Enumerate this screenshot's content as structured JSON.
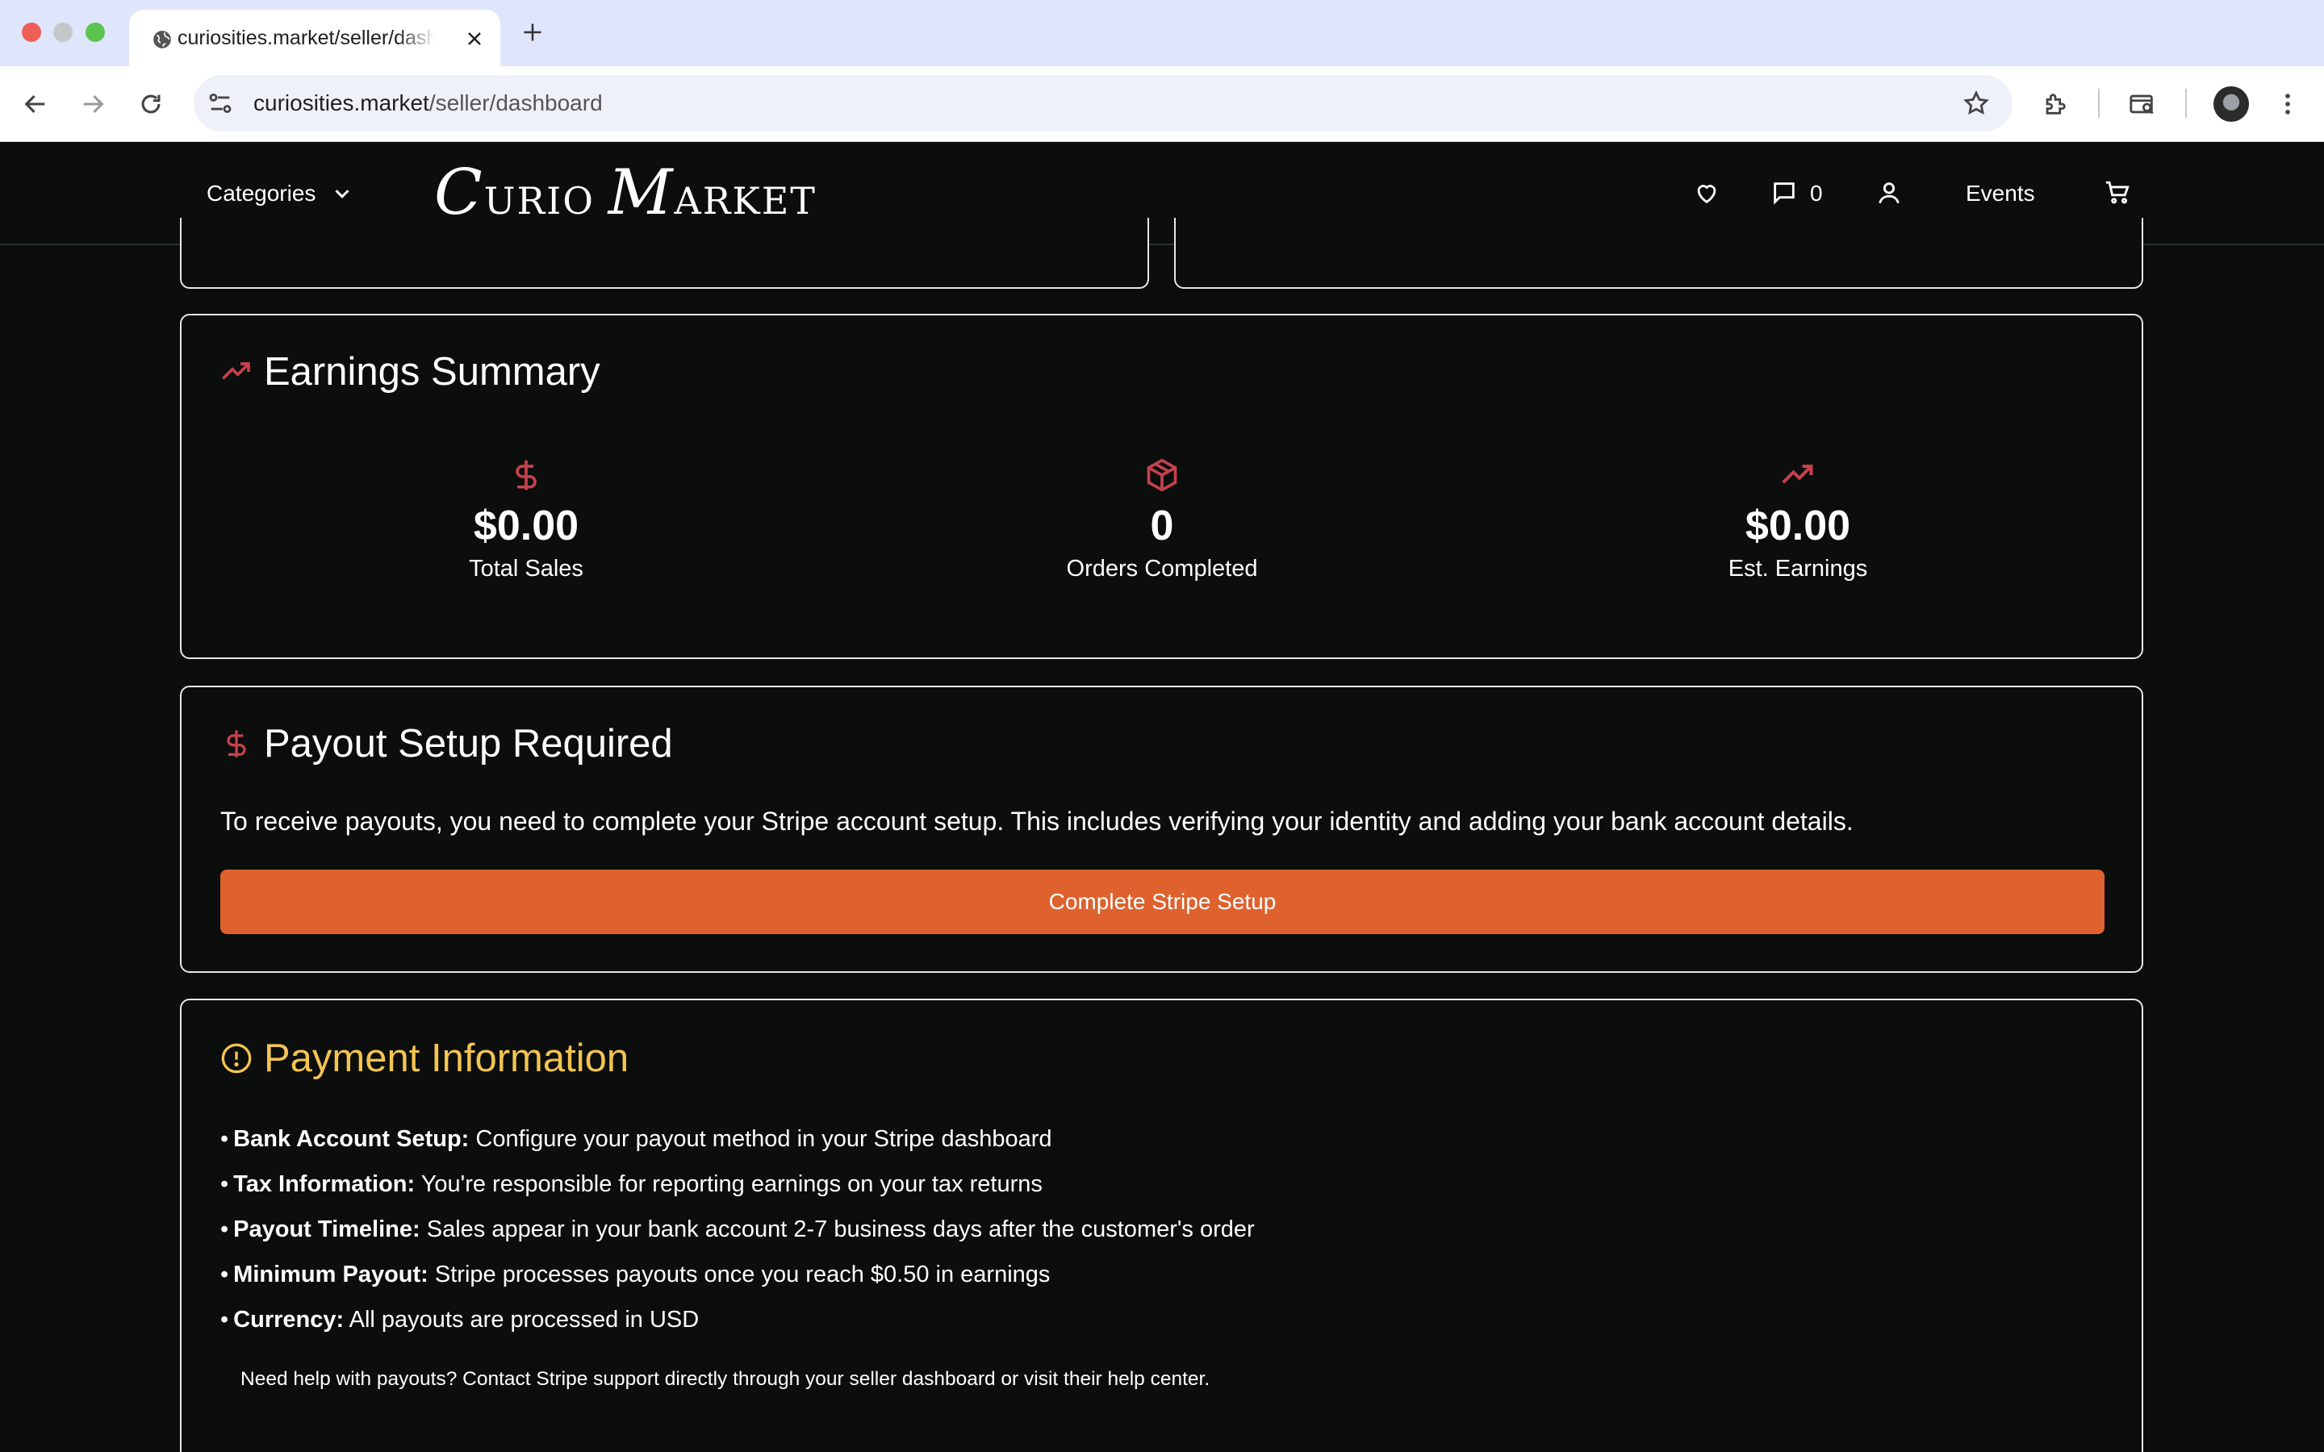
{
  "browser": {
    "tab_title": "curiosities.market/seller/dashboard",
    "url_domain": "curiosities.market",
    "url_path": "/seller/dashboard"
  },
  "header": {
    "categories_label": "Categories",
    "logo_c": "C",
    "logo_urio": "URIO ",
    "logo_m": "M",
    "logo_arket": "ARKET",
    "messages_count": "0",
    "events_label": "Events"
  },
  "earnings": {
    "title": "Earnings Summary",
    "stats": [
      {
        "value": "$0.00",
        "label": "Total Sales",
        "icon": "dollar-icon"
      },
      {
        "value": "0",
        "label": "Orders Completed",
        "icon": "package-icon"
      },
      {
        "value": "$0.00",
        "label": "Est. Earnings",
        "icon": "trending-up-icon"
      }
    ]
  },
  "payout": {
    "title": "Payout Setup Required",
    "text": "To receive payouts, you need to complete your Stripe account setup. This includes verifying your identity and adding your bank account details.",
    "button_label": "Complete Stripe Setup"
  },
  "payment_info": {
    "title": "Payment Information",
    "items": [
      {
        "bold": "Bank Account Setup:",
        "text": " Configure your payout method in your Stripe dashboard"
      },
      {
        "bold": "Tax Information:",
        "text": " You're responsible for reporting earnings on your tax returns"
      },
      {
        "bold": "Payout Timeline:",
        "text": " Sales appear in your bank account 2-7 business days after the customer's order"
      },
      {
        "bold": "Minimum Payout:",
        "text": " Stripe processes payouts once you reach $0.50 in earnings"
      },
      {
        "bold": "Currency:",
        "text": " All payouts are processed in USD"
      }
    ],
    "help_text": "Need help with payouts? Contact Stripe support directly through your seller dashboard or visit their help center."
  },
  "colors": {
    "accent_red": "#c6414a",
    "button_orange": "#de612e",
    "warning_yellow": "#f3c44f",
    "background": "#0c0d0d"
  }
}
